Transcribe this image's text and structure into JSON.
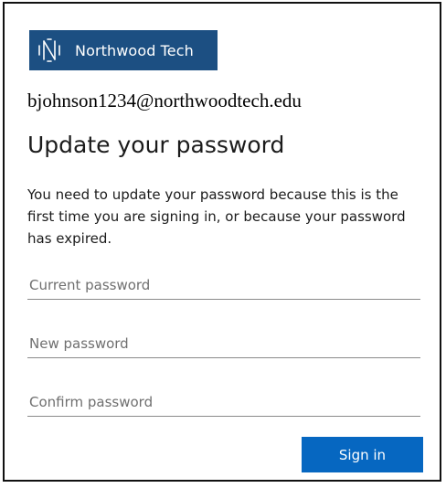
{
  "brand": {
    "name": "Northwood Tech",
    "logo_icon": "northwood-n-logo-icon",
    "color": "#1c4f82"
  },
  "account": {
    "email": "bjohnson1234@northwoodtech.edu"
  },
  "form": {
    "title": "Update your password",
    "description": "You need to update your password because this is the first time you are signing in, or because your password has expired.",
    "current_password_placeholder": "Current password",
    "new_password_placeholder": "New password",
    "confirm_password_placeholder": "Confirm password",
    "submit_label": "Sign in",
    "submit_color": "#0667c1"
  }
}
